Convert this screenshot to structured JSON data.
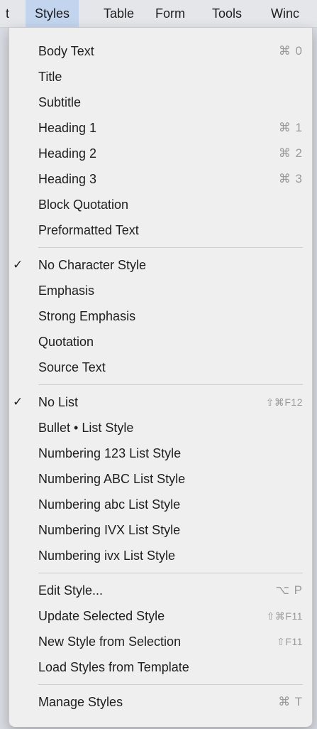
{
  "menubar": {
    "items": [
      {
        "label": "t"
      },
      {
        "label": "Styles"
      },
      {
        "label": "Table"
      },
      {
        "label": "Form"
      },
      {
        "label": "Tools"
      },
      {
        "label": "Winc"
      }
    ]
  },
  "menu": {
    "groups": [
      [
        {
          "label": "Body Text",
          "shortcut": "⌘ 0"
        },
        {
          "label": "Title",
          "shortcut": ""
        },
        {
          "label": "Subtitle",
          "shortcut": ""
        },
        {
          "label": "Heading 1",
          "shortcut": "⌘ 1"
        },
        {
          "label": "Heading 2",
          "shortcut": "⌘ 2"
        },
        {
          "label": "Heading 3",
          "shortcut": "⌘ 3"
        },
        {
          "label": "Block Quotation",
          "shortcut": ""
        },
        {
          "label": "Preformatted Text",
          "shortcut": ""
        }
      ],
      [
        {
          "label": "No Character Style",
          "shortcut": "",
          "checked": "✓"
        },
        {
          "label": "Emphasis",
          "shortcut": ""
        },
        {
          "label": "Strong Emphasis",
          "shortcut": ""
        },
        {
          "label": "Quotation",
          "shortcut": ""
        },
        {
          "label": "Source Text",
          "shortcut": ""
        }
      ],
      [
        {
          "label": "No List",
          "shortcut": "⇧⌘F12",
          "checked": "✓"
        },
        {
          "label": "Bullet • List Style",
          "shortcut": ""
        },
        {
          "label": "Numbering 123 List Style",
          "shortcut": ""
        },
        {
          "label": "Numbering ABC List Style",
          "shortcut": ""
        },
        {
          "label": "Numbering abc List Style",
          "shortcut": ""
        },
        {
          "label": "Numbering IVX List Style",
          "shortcut": ""
        },
        {
          "label": "Numbering ivx List Style",
          "shortcut": ""
        }
      ],
      [
        {
          "label": "Edit Style...",
          "shortcut": "⌥ P"
        },
        {
          "label": "Update Selected Style",
          "shortcut": "⇧⌘F11"
        },
        {
          "label": "New Style from Selection",
          "shortcut": "⇧F11"
        },
        {
          "label": "Load Styles from Template",
          "shortcut": ""
        }
      ],
      [
        {
          "label": "Manage Styles",
          "shortcut": "⌘ T"
        }
      ]
    ]
  },
  "colors": {
    "menubar_active": "#c3d5ee",
    "menu_background": "#efefef",
    "shortcut_text": "#9a9a9a"
  }
}
